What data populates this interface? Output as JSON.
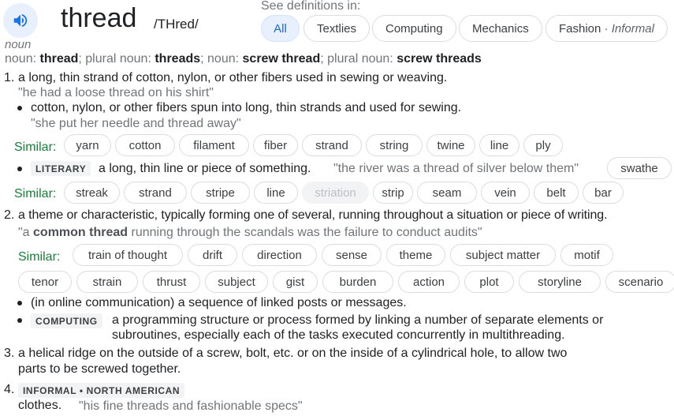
{
  "header": {
    "word": "thread",
    "phonetic": "/THred/",
    "see_definitions_label": "See definitions in:",
    "speaker_icon": "speaker-icon"
  },
  "tabs": [
    {
      "label": "All",
      "active": true
    },
    {
      "label": "Textlies"
    },
    {
      "label": "Computing"
    },
    {
      "label": "Mechanics"
    },
    {
      "label": "Fashion",
      "sep": " · ",
      "note": "Informal"
    }
  ],
  "entry": {
    "pos": "noun",
    "forms": {
      "k1": "noun: ",
      "v1": "thread",
      "s1": "; plural noun: ",
      "v2": "threads",
      "s2": "; noun: ",
      "v3": "screw thread",
      "s3": "; plural noun: ",
      "v4": "screw threads"
    }
  },
  "def1": {
    "num": "1.",
    "text": "a long, thin strand of cotton, nylon, or other fibers used in sewing or weaving.",
    "example": "\"he had a loose thread on his shirt\"",
    "sub1": {
      "text": "cotton, nylon, or other fibers spun into long, thin strands and used for sewing.",
      "example": "\"she put her needle and thread away\""
    },
    "similar_label": "Similar:",
    "similar1": [
      "yarn",
      "cotton",
      "filament",
      "fiber",
      "strand",
      "string",
      "twine",
      "line",
      "ply"
    ],
    "sub2": {
      "tag": "LITERARY",
      "text": "a long, thin line or piece of something.",
      "example": "\"the river was a thread of silver below them\"",
      "extra_chip": "swathe"
    },
    "similar2": [
      "streak",
      "strand",
      "stripe",
      "line",
      "striation",
      "strip",
      "seam",
      "vein",
      "belt",
      "bar"
    ]
  },
  "def2": {
    "num": "2.",
    "text": "a theme or characteristic, typically forming one of several, running throughout a situation or piece of writing.",
    "example_pre": "\"a ",
    "example_bold": "common thread",
    "example_post": " running through the scandals was the failure to conduct audits\"",
    "similar_label": "Similar:",
    "similar_row1": [
      "train of thought",
      "drift",
      "direction",
      "sense",
      "theme",
      "subject matter",
      "motif"
    ],
    "similar_row2": [
      "tenor",
      "strain",
      "thrust",
      "subject",
      "gist",
      "burden",
      "action",
      "plot",
      "storyline",
      "scenario"
    ],
    "sub1": {
      "text": "(in online communication) a sequence of linked posts or messages."
    },
    "sub2": {
      "tag": "COMPUTING",
      "text_line1": "a programming structure or process formed by linking a number of separate elements or",
      "text_line2": "subroutines, especially each of the tasks executed concurrently in multithreading."
    }
  },
  "def3": {
    "num": "3.",
    "text_line1": "a helical ridge on the outside of a screw, bolt, etc. or on the inside of a cylindrical hole, to allow two",
    "text_line2": "parts to be screwed together."
  },
  "def4": {
    "num": "4.",
    "tag": "INFORMAL • NORTH AMERICAN",
    "text": "clothes.",
    "example": "\"his fine threads and fashionable specs\""
  }
}
